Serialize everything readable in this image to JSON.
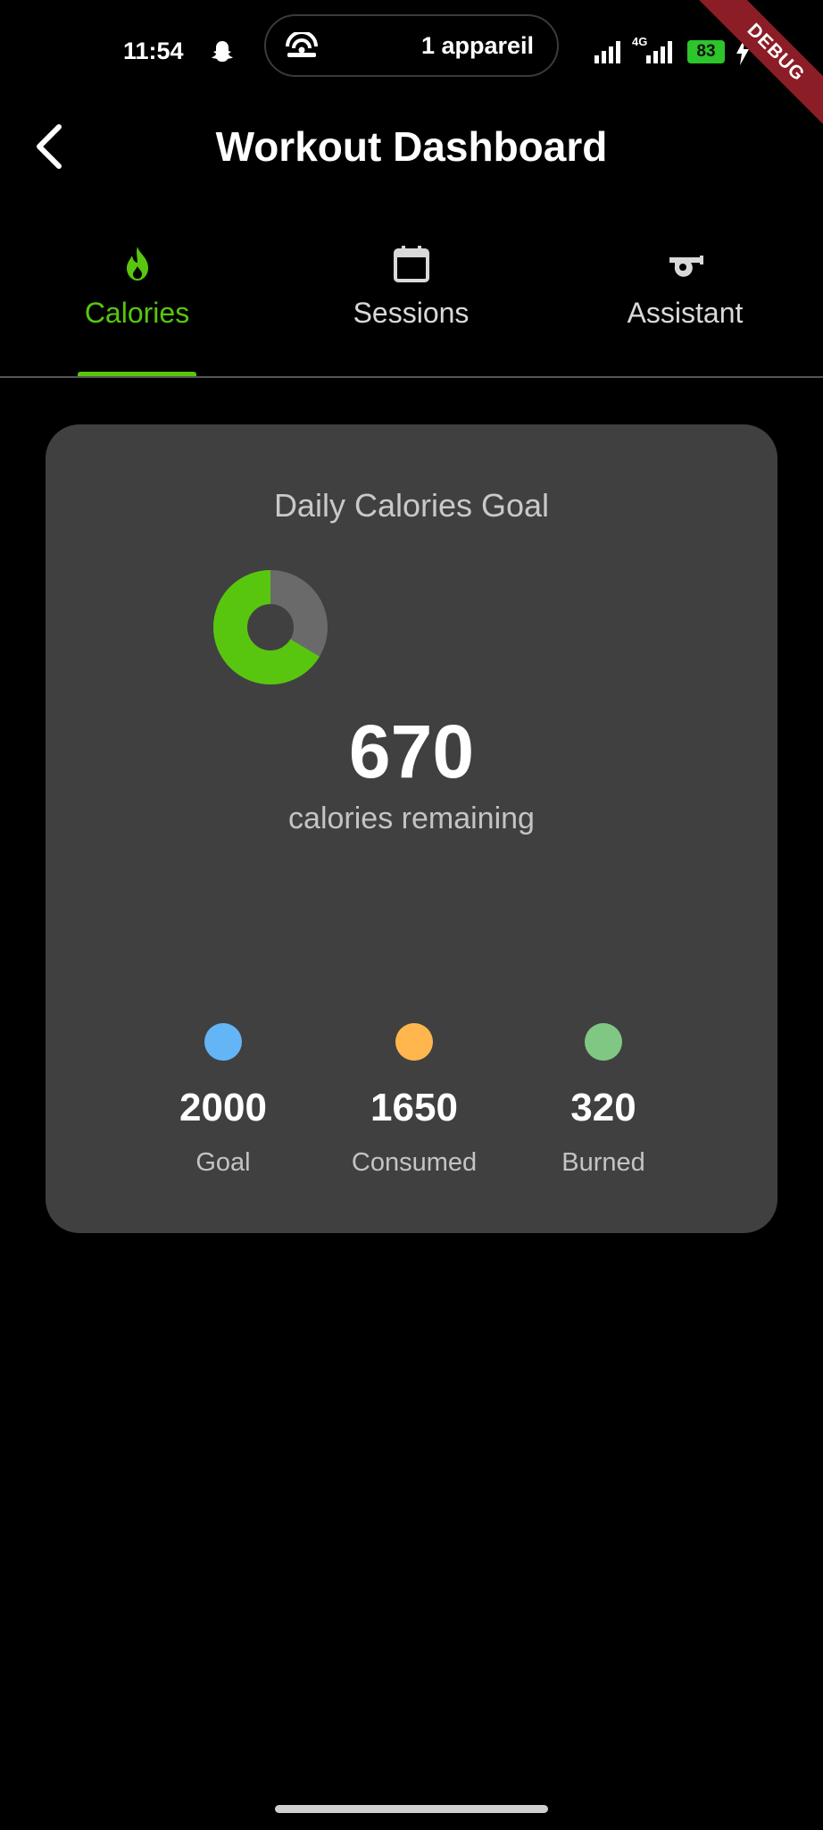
{
  "status_bar": {
    "time": "11:54",
    "hotspot_text": "1 appareil",
    "network_type": "4G",
    "battery_level": "83",
    "debug_label": "DEBUG"
  },
  "app_bar": {
    "title": "Workout Dashboard",
    "back_icon": "chevron-left-icon"
  },
  "tabs": [
    {
      "label": "Calories",
      "icon": "flame-icon",
      "active": true
    },
    {
      "label": "Sessions",
      "icon": "calendar-icon",
      "active": false
    },
    {
      "label": "Assistant",
      "icon": "whistle-icon",
      "active": false
    }
  ],
  "colors": {
    "accent": "#58c60e",
    "card_bg": "#404040",
    "donut_track": "#6a6a6a",
    "goal_dot": "#64b5f6",
    "consumed_dot": "#ffb74d",
    "burned_dot": "#81c784"
  },
  "card": {
    "title": "Daily Calories Goal",
    "remaining_value": "670",
    "remaining_label": "calories remaining",
    "progress_fraction": 0.665,
    "stats": [
      {
        "value": "2000",
        "label": "Goal",
        "color": "#64b5f6"
      },
      {
        "value": "1650",
        "label": "Consumed",
        "color": "#ffb74d"
      },
      {
        "value": "320",
        "label": "Burned",
        "color": "#81c784"
      }
    ]
  }
}
